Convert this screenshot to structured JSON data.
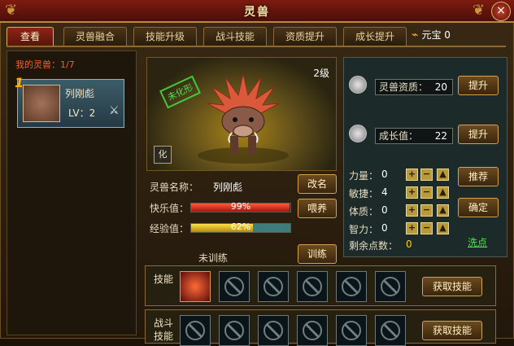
{
  "window": {
    "title": "灵兽",
    "close": "×",
    "ornament": "❦"
  },
  "tabs": [
    {
      "label": "查看",
      "active": true
    },
    {
      "label": "灵兽融合",
      "active": false
    },
    {
      "label": "技能升级",
      "active": false
    },
    {
      "label": "战斗技能",
      "active": false
    },
    {
      "label": "资质提升",
      "active": false
    },
    {
      "label": "成长提升",
      "active": false
    }
  ],
  "currency": {
    "label": "元宝",
    "value": "0",
    "icon": "gold-ingot-icon"
  },
  "beast_list": {
    "title": "我的灵兽：1/7",
    "items": [
      {
        "index": "1",
        "name": "列刚彪",
        "level": "LV：2",
        "icon": "crossed-swords-icon"
      }
    ]
  },
  "portrait": {
    "level": "2级",
    "stamp": "未化形",
    "morph_button": "化"
  },
  "info": {
    "name_label": "灵兽名称：",
    "name_value": "列刚彪",
    "happiness_label": "快乐值：",
    "happiness_pct": "99%",
    "happiness_value": 0.99,
    "exp_label": "经验值：",
    "exp_pct": "62%",
    "exp_value": 0.62,
    "training_status": "未训练",
    "rename_button": "改名",
    "feed_button": "喂养",
    "train_button": "训练"
  },
  "stats": {
    "aptitude_label": "灵兽资质：",
    "aptitude_value": "20",
    "aptitude_button": "提升",
    "growth_label": "成长值：",
    "growth_value": "22",
    "growth_button": "提升",
    "attributes": [
      {
        "label": "力量：",
        "value": "0"
      },
      {
        "label": "敏捷：",
        "value": "4"
      },
      {
        "label": "体质：",
        "value": "0"
      },
      {
        "label": "智力：",
        "value": "0"
      }
    ],
    "remaining_label": "剩余点数：",
    "remaining_value": "0",
    "recommend_button": "推荐",
    "confirm_button": "确定",
    "wash_link": "洗点",
    "plus": "+",
    "minus": "−",
    "up": "▲"
  },
  "skills": {
    "skill_row_label": "技能",
    "battle_row_label": "战斗技能",
    "get_skill_button": "获取技能"
  }
}
